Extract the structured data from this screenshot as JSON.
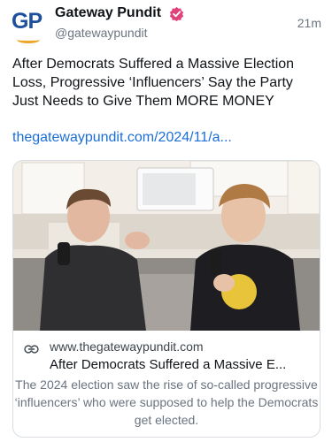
{
  "author": {
    "avatar_text": "GP",
    "name": "Gateway Pundit",
    "handle": "@gatewaypundit",
    "verified_icon": "verified-badge-icon",
    "verified_color": "#e0427a"
  },
  "post": {
    "time": "21m",
    "text": "After Democrats Suffered a Massive Election Loss, Progressive ‘Influencers’ Say the Party Just Needs to Give Them MORE MONEY",
    "link": "thegatewaypundit.com/2024/11/a..."
  },
  "card": {
    "link_icon": "link-icon",
    "domain": "www.thegatewaypundit.com",
    "title": "After Democrats Suffered a Massive E...",
    "description": "The 2024 election saw the rise of so-called progressive ‘influencers’ who were supposed to help the Democrats get elected."
  },
  "colors": {
    "link": "#1a6ed8",
    "brand_blue": "#1d4f9c",
    "brand_orange": "#f2a52b"
  }
}
